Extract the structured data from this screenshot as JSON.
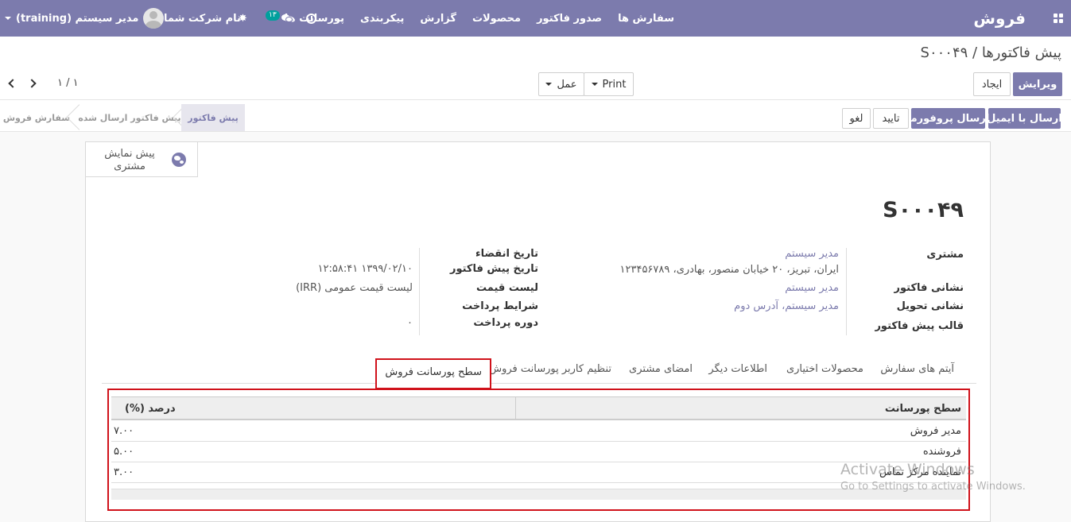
{
  "navbar": {
    "brand": "فروش",
    "menu": [
      "سفارش ها",
      "صدور فاکتور",
      "محصولات",
      "گزارش",
      "پیکربندی",
      "پورسانت ها"
    ],
    "chat_badge": "۱۳",
    "company": "نام شرکت شما",
    "user": "مدیر سیستم (training)",
    "bg_color": "#7c7bad"
  },
  "breadcrumb": {
    "parent": "پیش فاکتورها",
    "separator": "/",
    "current": "S۰۰۰۴۹"
  },
  "buttons": {
    "edit": "ویرایش",
    "create": "ایجاد",
    "print": "Print",
    "action": "عمل",
    "send_email": "ارسال با ایمیل",
    "send_proforma": "ارسال پروفورما",
    "confirm": "تایید",
    "cancel": "لغو"
  },
  "pager": {
    "value": "۱ / ۱"
  },
  "status_stages": [
    "سفارش فروش",
    "پیش فاکتور ارسال شده",
    "پیش فاکتور"
  ],
  "active_stage": "پیش فاکتور",
  "smart_button": {
    "label": "پیش نمایش مشتری",
    "icon": "globe-icon"
  },
  "document": {
    "title": "S۰۰۰۴۹",
    "fields_right": [
      {
        "label": "مشتری",
        "value": "مدیر سیستم",
        "value2": "ایران، تبریز، ۲۰ خیابان منصور، بهادری، ۱۲۳۴۵۶۷۸۹"
      },
      {
        "label": "نشانی فاکتور",
        "value": "مدیر سیستم"
      },
      {
        "label": "نشانی تحویل",
        "value": "مدیر سیستم، آدرس دوم"
      },
      {
        "label": "قالب پیش فاکتور",
        "value": ""
      }
    ],
    "fields_left": [
      {
        "label": "تاریخ انقضاء",
        "value": ""
      },
      {
        "label": "تاریخ پیش فاکتور",
        "value": "۱۳۹۹/۰۲/۱۰ ۱۲:۵۸:۴۱"
      },
      {
        "label": "لیست قیمت",
        "value": "لیست قیمت عمومی (IRR)"
      },
      {
        "label": "شرایط پرداخت",
        "value": ""
      },
      {
        "label": "دوره پرداخت",
        "value": "۰"
      }
    ]
  },
  "tabs": [
    "آیتم های سفارش",
    "محصولات اختیاری",
    "اطلاعات دیگر",
    "امضای مشتری",
    "تنظیم کاربر پورسانت فروش",
    "سطح پورسانت فروش"
  ],
  "active_tab": "سطح پورسانت فروش",
  "commission_table": {
    "columns": [
      "سطح پورسانت",
      "درصد (%)"
    ],
    "rows": [
      {
        "level": "مدیر فروش",
        "percent": "۷.۰۰"
      },
      {
        "level": "فروشنده",
        "percent": "۵.۰۰"
      },
      {
        "level": "نماینده مرکز تماس",
        "percent": "۳.۰۰"
      }
    ]
  },
  "watermark": {
    "line1": "Activate Windows",
    "line2": "Go to Settings to activate Windows."
  }
}
